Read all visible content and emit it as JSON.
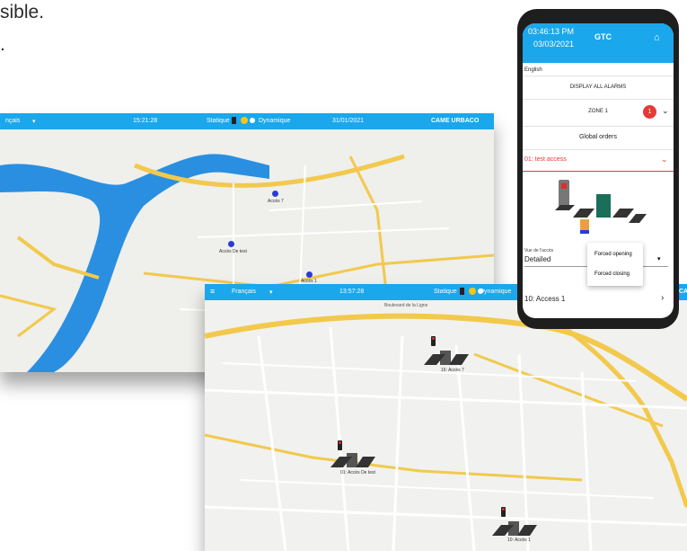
{
  "page_text": {
    "line1": "sible.",
    "line2": "."
  },
  "dashboard_back": {
    "language": "nçais",
    "time": "15:21:28",
    "mode_static": "Statique",
    "mode_dynamic": "Dynamique",
    "date": "31/01/2021",
    "brand": "CAME URBACO",
    "pins": [
      {
        "label": "Accès 7"
      },
      {
        "label": "Accès De test"
      },
      {
        "label": "Accès 1"
      }
    ]
  },
  "dashboard_front": {
    "language": "Français",
    "time": "13:57:28",
    "mode_static": "Statique",
    "mode_dynamic": "Dynamique",
    "brand_fragment": "CA",
    "street_top": "Boulevard de la Ligne",
    "accesses": [
      {
        "label": "16: Accès 7"
      },
      {
        "label": "01: Accès De test"
      },
      {
        "label": "10: Accès 1"
      }
    ]
  },
  "phone": {
    "time": "03:46:13 PM",
    "date": "03/03/2021",
    "title": "GTC",
    "language": "English",
    "display_alarms": "DISPLAY ALL ALARMS",
    "zone": "ZONE 1",
    "zone_badge": "1",
    "global_orders": "Global orders",
    "selected_access": "01: test access",
    "view_label": "Vue de l'accès",
    "view_value": "Detailed",
    "menu_forced_opening": "Forced opening",
    "menu_forced_closing": "Forced closing",
    "access_item": "10: Access 1"
  },
  "colors": {
    "accent": "#1aa7ec",
    "alert": "#e53935",
    "pin": "#2a3bd6",
    "river": "#2a8fe0"
  }
}
